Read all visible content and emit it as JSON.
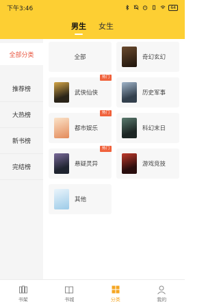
{
  "status": {
    "time": "下午3:46",
    "battery": "64"
  },
  "tabs": [
    {
      "label": "男生",
      "active": true
    },
    {
      "label": "女生",
      "active": false
    }
  ],
  "sidebar": {
    "items": [
      {
        "label": "全部分类",
        "active": true
      },
      {
        "label": "推荐榜",
        "active": false
      },
      {
        "label": "大热榜",
        "active": false
      },
      {
        "label": "新书榜",
        "active": false
      },
      {
        "label": "完结榜",
        "active": false
      }
    ]
  },
  "categories": [
    {
      "label": "全部",
      "badge": "",
      "cover_color": ""
    },
    {
      "label": "奇幻玄幻",
      "badge": "",
      "cover_color": "#3b2a1e"
    },
    {
      "label": "武侠仙侠",
      "badge": "热门",
      "cover_color": "#2a2418"
    },
    {
      "label": "历史军事",
      "badge": "",
      "cover_color": "#33404d"
    },
    {
      "label": "都市娱乐",
      "badge": "热门",
      "cover_color": "#e9c7a4"
    },
    {
      "label": "科幻末日",
      "badge": "",
      "cover_color": "#2d3a38"
    },
    {
      "label": "悬疑灵异",
      "badge": "热门",
      "cover_color": "#1f2430"
    },
    {
      "label": "游戏竞技",
      "badge": "",
      "cover_color": "#5a1f1f"
    },
    {
      "label": "其他",
      "badge": "",
      "cover_color": "#b9d9f0"
    }
  ],
  "bottom_nav": [
    {
      "label": "书架",
      "icon": "bookshelf-icon",
      "active": false
    },
    {
      "label": "书城",
      "icon": "book-icon",
      "active": false
    },
    {
      "label": "分类",
      "icon": "category-grid-icon",
      "active": true
    },
    {
      "label": "我的",
      "icon": "profile-icon",
      "active": false
    }
  ],
  "colors": {
    "accent": "#FDCF33",
    "active_red": "#E8553F",
    "hot_badge": "#F0623C",
    "nav_active": "#F5A623"
  }
}
